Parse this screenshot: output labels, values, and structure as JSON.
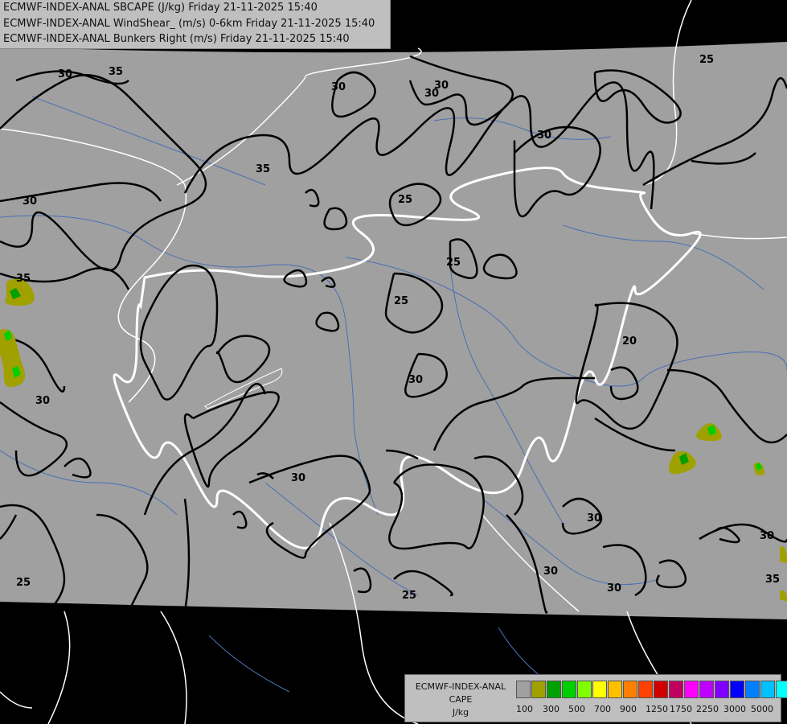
{
  "header": {
    "line1": "ECMWF-INDEX-ANAL SBCAPE (J/kg) Friday 21-11-2025 15:40",
    "line2": "ECMWF-INDEX-ANAL WindShear_ (m/s) 0-6km Friday 21-11-2025 15:40",
    "line3": "ECMWF-INDEX-ANAL Bunkers Right (m/s) Friday 21-11-2025 15:40"
  },
  "legend": {
    "title1": "ECMWF-INDEX-ANAL",
    "title2": "CAPE",
    "title3": "J/kg",
    "colors": [
      "#a0a0a0",
      "#a0a000",
      "#00a000",
      "#00d000",
      "#80ff00",
      "#ffff00",
      "#ffc000",
      "#ff8000",
      "#ff4000",
      "#d00000",
      "#c00060",
      "#ff00ff",
      "#c000ff",
      "#8000ff",
      "#0000ff",
      "#0080ff",
      "#00c0ff",
      "#00ffff",
      "#80ffff",
      "#ffffff"
    ],
    "ticks": [
      "100",
      "300",
      "500",
      "700",
      "900",
      "1250",
      "1750",
      "2250",
      "3000",
      "5000"
    ]
  },
  "contour_labels": [
    {
      "text": "30"
    },
    {
      "text": "35"
    },
    {
      "text": "30"
    },
    {
      "text": "30"
    },
    {
      "text": "25"
    },
    {
      "text": "35"
    },
    {
      "text": "30"
    },
    {
      "text": "30"
    },
    {
      "text": "25"
    },
    {
      "text": "25"
    },
    {
      "text": "25"
    },
    {
      "text": "35"
    },
    {
      "text": "20"
    },
    {
      "text": "30"
    },
    {
      "text": "30"
    },
    {
      "text": "30"
    },
    {
      "text": "30"
    },
    {
      "text": "30"
    },
    {
      "text": "30"
    },
    {
      "text": "25"
    },
    {
      "text": "25"
    },
    {
      "text": "30"
    },
    {
      "text": "35"
    },
    {
      "text": "30"
    },
    {
      "text": "30"
    }
  ],
  "colors": {
    "map_fill": "#a0a0a0",
    "background": "#000000",
    "contour": "#000000",
    "border": "#ffffff",
    "river": "#4a6fb5"
  }
}
